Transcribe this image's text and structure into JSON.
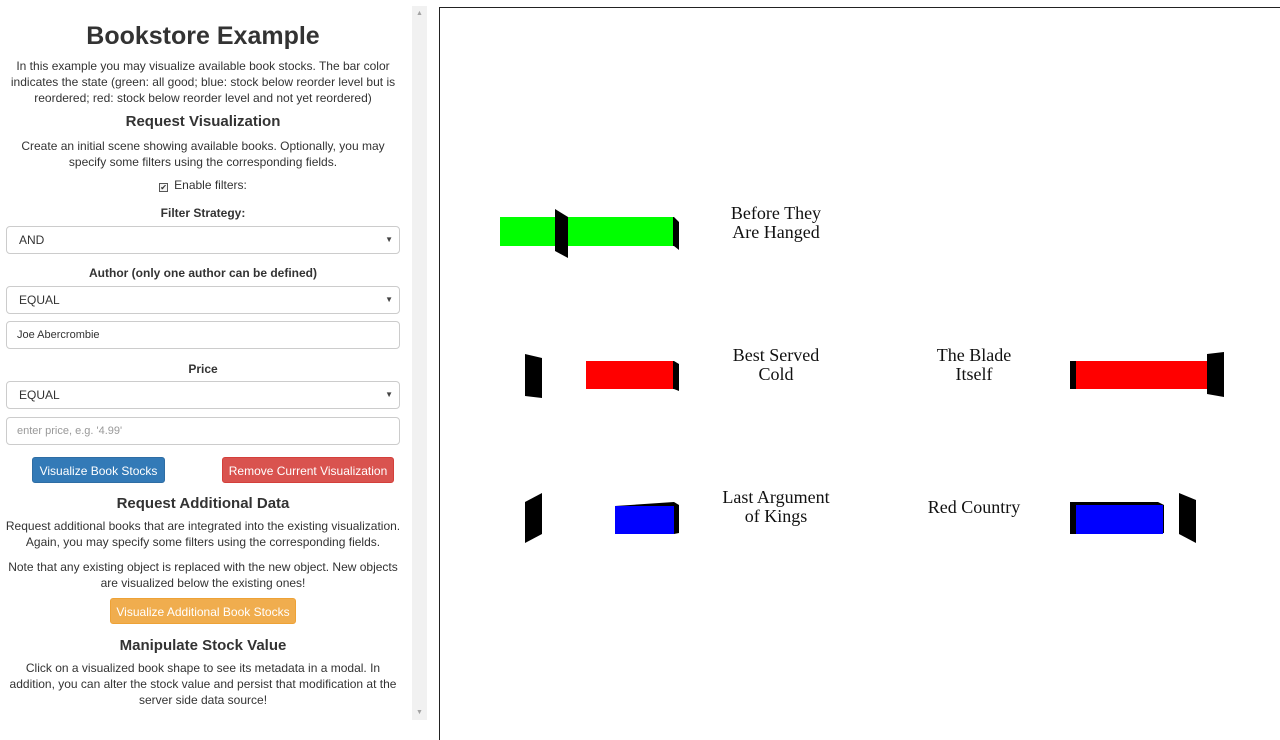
{
  "left": {
    "title": "Bookstore Example",
    "intro": "In this example you may visualize available book stocks. The bar color indicates the state (green: all good; blue: stock below reorder level but is reordered; red: stock below reorder level and not yet reordered)",
    "request_heading": "Request Visualization",
    "request_text": "Create an initial scene showing available books. Optionally, you may specify some filters using the corresponding fields.",
    "enable_filters_label": "Enable filters:",
    "filter_strategy_label": "Filter Strategy:",
    "filter_strategy_value": "AND",
    "author_label": "Author (only one author can be defined)",
    "author_operator": "EQUAL",
    "author_value": "Joe Abercrombie",
    "price_label": "Price",
    "price_operator": "EQUAL",
    "price_placeholder": "enter price, e.g. '4.99'",
    "visualize_button": "Visualize Book Stocks",
    "remove_button": "Remove Current Visualization",
    "additional_heading": "Request Additional Data",
    "additional_text": "Request additional books that are integrated into the existing visualization. Again, you may specify some filters using the corresponding fields.",
    "note_text": "Note that any existing object is replaced with the new object. New objects are visualized below the existing ones!",
    "additional_button": "Visualize Additional Book Stocks",
    "manipulate_heading": "Manipulate Stock Value",
    "manipulate_text": "Click on a visualized book shape to see its metadata in a modal. In addition, you can alter the stock value and persist that modification at the server side data source!"
  },
  "scene": {
    "books": [
      {
        "title_line1": "Before They",
        "title_line2": "Are Hanged",
        "state": "green",
        "color": "#00ff00",
        "stock_fraction": 1.0
      },
      {
        "title_line1": "Best Served",
        "title_line2": "Cold",
        "state": "red",
        "color": "#ff0000",
        "stock_fraction": 0.6
      },
      {
        "title_line1": "The Blade",
        "title_line2": "Itself",
        "state": "red",
        "color": "#ff0000",
        "stock_fraction": 0.95
      },
      {
        "title_line1": "Last Argument",
        "title_line2": "of Kings",
        "state": "blue",
        "color": "#0000ff",
        "stock_fraction": 0.4
      },
      {
        "title_line1": "Red Country",
        "title_line2": "",
        "state": "blue",
        "color": "#0000ff",
        "stock_fraction": 0.6
      }
    ]
  },
  "icons": {
    "caret": "chevron-down-icon",
    "checkbox": "checkbox-checked-icon"
  }
}
